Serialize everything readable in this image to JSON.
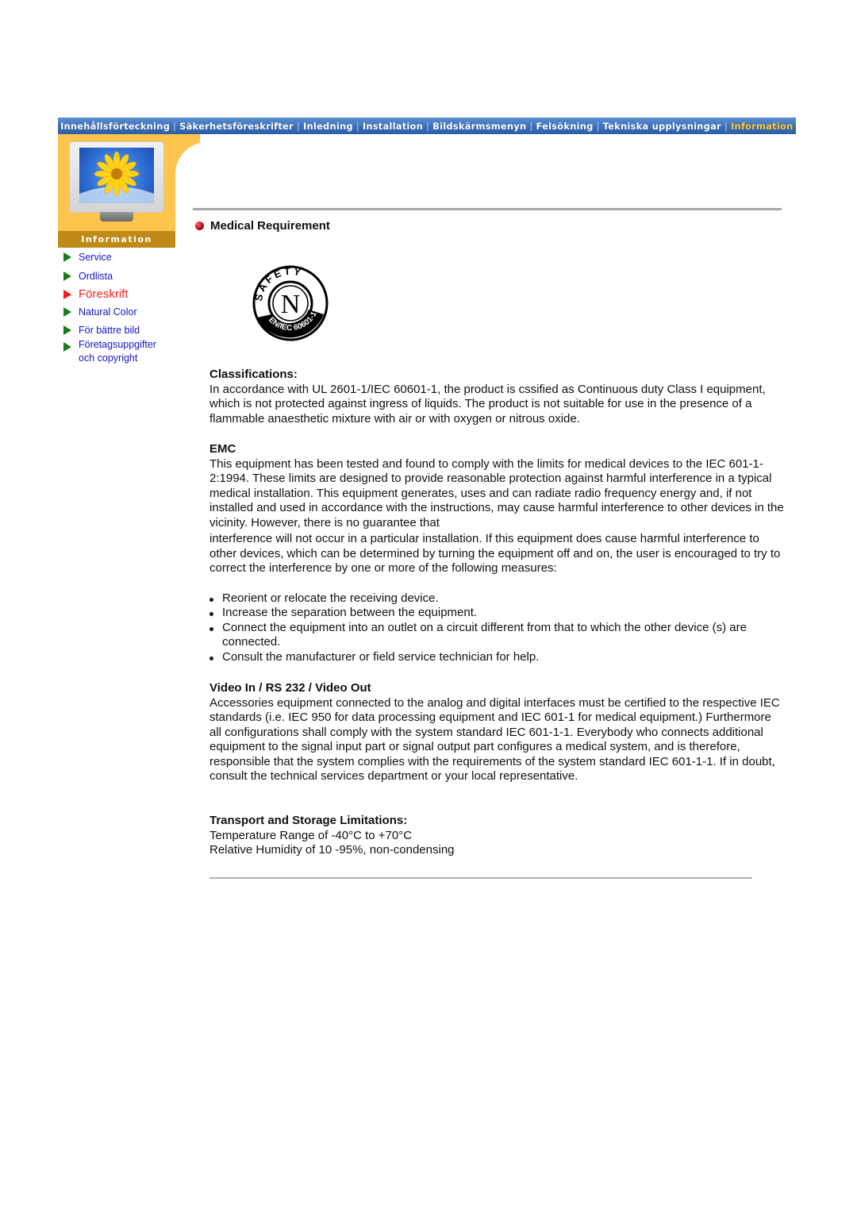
{
  "nav": {
    "items": [
      {
        "label": "Innehållsförteckning",
        "active": false
      },
      {
        "label": "Säkerhetsföreskrifter",
        "active": false
      },
      {
        "label": "Inledning",
        "active": false
      },
      {
        "label": "Installation",
        "active": false
      },
      {
        "label": "Bildskärmsmenyn",
        "active": false
      },
      {
        "label": "Felsökning",
        "active": false
      },
      {
        "label": "Tekniska upplysningar",
        "active": false
      },
      {
        "label": "Information",
        "active": true
      }
    ],
    "separator": "|"
  },
  "sidebar": {
    "section_label": "Information",
    "items": [
      {
        "label": "Service",
        "active": false
      },
      {
        "label": "Ordlista",
        "active": false
      },
      {
        "label": "Föreskrift",
        "active": true
      },
      {
        "label": "Natural Color",
        "active": false
      },
      {
        "label": "För bättre bild",
        "active": false
      },
      {
        "label": "Företagsuppgifter och copyright",
        "active": false
      }
    ]
  },
  "page": {
    "title": "Medical Requirement",
    "logo": {
      "ring_text": "SAFETY",
      "center": "N",
      "lower_text": "EN/IEC 60601-1"
    },
    "sections": {
      "classifications": {
        "heading": "Classifications:",
        "text": "In accordance with UL 2601-1/IEC 60601-1, the product is cssified as Continuous duty Class I equipment, which is not protected against ingress of liquids. The product is not suitable for use in the presence of a flammable anaesthetic mixture with air or with oxygen or nitrous oxide."
      },
      "emc": {
        "heading": "EMC",
        "text1": "This equipment has been tested and found to comply with the limits for medical devices to the IEC 601-1-2:1994. These limits are designed to provide reasonable protection against harmful interference in a typical medical installation. This equipment generates, uses and can radiate radio frequency energy and, if not installed and used in accordance with the instructions, may cause harmful interference to other devices in the vicinity. However, there is no guarantee that",
        "text2": "interference will not occur in a particular installation. If this equipment does cause harmful interference to other devices, which can be determined by turning the equipment off and on, the user is encouraged to try to correct the interference by one or more of the following measures:",
        "bullets": [
          "Reorient or relocate the receiving device.",
          "Increase the separation between the equipment.",
          "Connect the equipment into an outlet on a circuit different from that to which the other device (s) are connected.",
          "Consult the manufacturer or field service technician for help."
        ]
      },
      "video": {
        "heading": "Video In / RS 232 / Video Out",
        "text": "Accessories equipment connected to the analog and digital interfaces must be certified to the respective IEC standards (i.e. IEC 950 for data processing equipment and IEC 601-1 for medical equipment.) Furthermore all configurations shall comply with the system standard IEC 601-1-1. Everybody who connects additional equipment to the signal input part or signal output part configures a medical system, and is therefore, responsible that the system complies with the requirements of the system standard IEC 601-1-1. If in doubt, consult the technical services department or your local representative."
      },
      "transport": {
        "heading": "Transport and Storage Limitations:",
        "line1": "Temperature Range of -40°C to +70°C",
        "line2": "Relative Humidity of 10 -95%, non-condensing"
      }
    }
  }
}
